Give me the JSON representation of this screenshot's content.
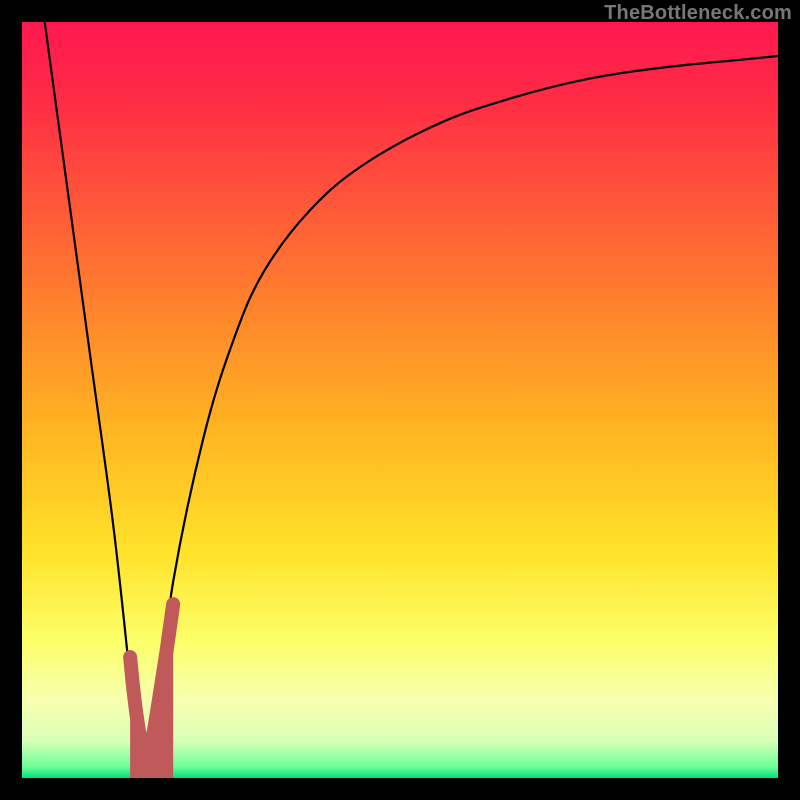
{
  "watermark": "TheBottleneck.com",
  "gradient": {
    "stops": [
      {
        "offset": 0.0,
        "color": "#ff1850"
      },
      {
        "offset": 0.1,
        "color": "#ff2b45"
      },
      {
        "offset": 0.25,
        "color": "#ff5a38"
      },
      {
        "offset": 0.4,
        "color": "#ff8a2a"
      },
      {
        "offset": 0.55,
        "color": "#ffb821"
      },
      {
        "offset": 0.7,
        "color": "#ffe22a"
      },
      {
        "offset": 0.82,
        "color": "#fcff6a"
      },
      {
        "offset": 0.9,
        "color": "#f6ffb0"
      },
      {
        "offset": 0.95,
        "color": "#d9ffb7"
      },
      {
        "offset": 0.985,
        "color": "#6eff9a"
      },
      {
        "offset": 1.0,
        "color": "#00e077"
      }
    ]
  },
  "chart_data": {
    "type": "line",
    "title": "",
    "xlabel": "",
    "ylabel": "",
    "xlim": [
      0,
      100
    ],
    "ylim": [
      0,
      100
    ],
    "series": [
      {
        "name": "bottleneck-curve",
        "x": [
          3,
          6,
          9,
          12,
          14,
          15,
          16,
          18,
          20,
          24,
          28,
          32,
          38,
          45,
          55,
          65,
          75,
          85,
          95,
          100
        ],
        "y": [
          100,
          78,
          56,
          34,
          16,
          6,
          2.5,
          10,
          26,
          45,
          58,
          67,
          75,
          81,
          86.5,
          90,
          92.5,
          94,
          95,
          95.5
        ]
      }
    ],
    "marker": {
      "name": "selection-hook",
      "color": "#c05a5a",
      "points_xy": [
        [
          14.3,
          16
        ],
        [
          14.7,
          12
        ],
        [
          15.2,
          8
        ],
        [
          15.8,
          4.5
        ],
        [
          16.3,
          3
        ],
        [
          17.0,
          4
        ],
        [
          17.9,
          9
        ],
        [
          19.0,
          16
        ],
        [
          20.0,
          23
        ]
      ],
      "stroke_width": 14,
      "bottom_fill_xy": [
        [
          14.3,
          16
        ],
        [
          16.3,
          3
        ],
        [
          20.0,
          23
        ],
        [
          20.0,
          0
        ],
        [
          14.3,
          0
        ]
      ]
    }
  }
}
